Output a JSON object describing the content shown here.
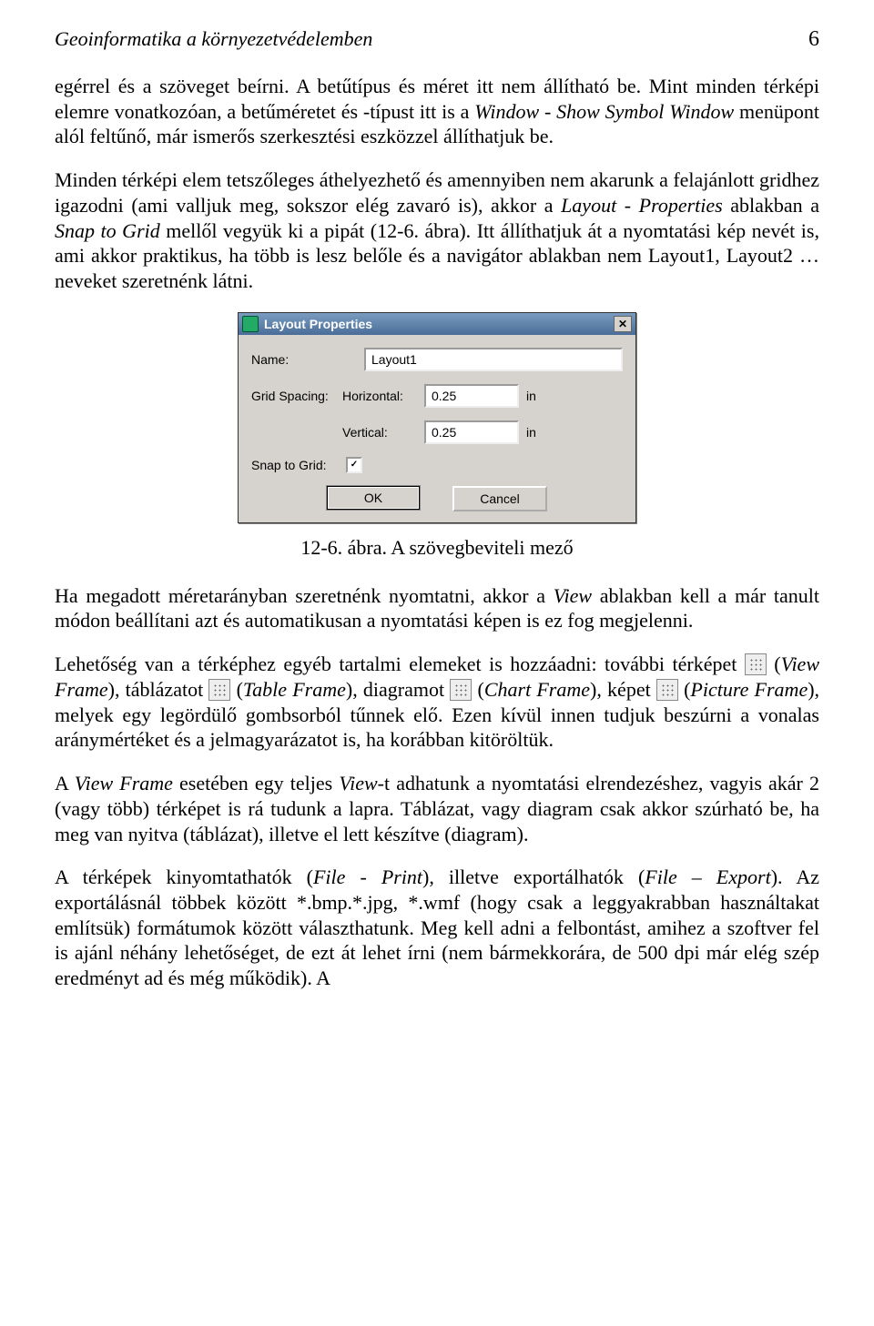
{
  "header": {
    "title": "Geoinformatika a környezetvédelemben",
    "page_number": "6"
  },
  "paragraphs": {
    "p1a": "egérrel és a szöveget beírni. A betűtípus és méret itt nem állítható be. Mint minden térképi elemre vonatkozóan, a betűméretet és -típust itt is a ",
    "p1b": "Window - Show Symbol Window",
    "p1c": " menüpont alól feltűnő, már ismerős szerkesztési eszközzel állíthatjuk be.",
    "p2a": "Minden térképi elem tetszőleges áthelyezhető és amennyiben nem akarunk a felajánlott gridhez igazodni (ami valljuk meg, sokszor elég zavaró is), akkor a ",
    "p2b": "Layout - Properties",
    "p2c": " ablakban a ",
    "p2d": "Snap to Grid",
    "p2e": " mellől vegyük ki a pipát (12-6. ábra). Itt állíthatjuk át a nyomtatási kép nevét is, ami akkor praktikus, ha több is lesz belőle és a navigátor ablakban nem Layout1, Layout2 … neveket szeretnénk látni.",
    "caption": "12-6. ábra. A szövegbeviteli mező",
    "p3a": "Ha megadott méretarányban szeretnénk nyomtatni, akkor a ",
    "p3b": "View",
    "p3c": " ablakban kell a már tanult módon beállítani azt és automatikusan a nyomtatási képen is ez fog megjelenni.",
    "p4a": "Lehetőség van a térképhez egyéb tartalmi elemeket is hozzáadni: további térképet ",
    "p4b": " (",
    "p4c": "View Frame",
    "p4d": "), táblázatot ",
    "p4e": " (",
    "p4f": "Table Frame",
    "p4g": "), diagramot ",
    "p4h": " (",
    "p4i": "Chart Frame",
    "p4j": "), képet ",
    "p4k": " (",
    "p4l": "Picture Frame",
    "p4m": "), melyek egy legördülő gombsorból tűnnek elő. Ezen kívül innen tudjuk beszúrni a vonalas aránymértéket és a jelmagyarázatot is, ha korábban kitöröltük.",
    "p5a": "A ",
    "p5b": "View Frame",
    "p5c": " esetében egy teljes ",
    "p5d": "View",
    "p5e": "-t adhatunk a nyomtatási elrendezéshez, vagyis akár 2 (vagy több) térképet is rá tudunk a lapra. Táblázat, vagy diagram csak akkor szúrható be, ha meg van nyitva (táblázat), illetve el lett készítve (diagram).",
    "p6a": "A térképek kinyomtathatók (",
    "p6b": "File - Print",
    "p6c": "), illetve exportálhatók (",
    "p6d": "File – Export",
    "p6e": "). Az exportálásnál többek között *.bmp.*.jpg, *.wmf (hogy csak a leggyakrabban használtakat említsük) formátumok között választhatunk. Meg kell adni a felbontást, amihez a szoftver fel is ajánl néhány lehetőséget, de ezt át lehet írni (nem bármekkorára, de 500 dpi már elég szép eredményt ad és még működik). A"
  },
  "dialog": {
    "title": "Layout Properties",
    "labels": {
      "name": "Name:",
      "grid_spacing": "Grid Spacing:",
      "horizontal": "Horizontal:",
      "vertical": "Vertical:",
      "snap_to_grid": "Snap to Grid:",
      "unit": "in"
    },
    "values": {
      "name": "Layout1",
      "horizontal": "0.25",
      "vertical": "0.25",
      "snap_checked": "✓"
    },
    "buttons": {
      "ok": "OK",
      "cancel": "Cancel"
    }
  }
}
